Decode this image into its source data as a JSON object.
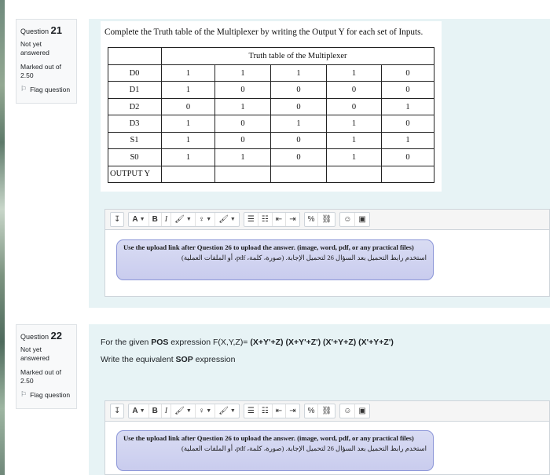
{
  "q21": {
    "label": "Question",
    "number": "21",
    "status": "Not yet answered",
    "marked": "Marked out of 2.50",
    "flag": "Flag question",
    "prompt": "Complete the Truth table of the Multiplexer by writing the Output Y for each set of Inputs.",
    "table": {
      "title": "Truth table of the Multiplexer",
      "rows": [
        {
          "label": "D0",
          "values": [
            "1",
            "1",
            "1",
            "1",
            "0"
          ]
        },
        {
          "label": "D1",
          "values": [
            "1",
            "0",
            "0",
            "0",
            "0"
          ]
        },
        {
          "label": "D2",
          "values": [
            "0",
            "1",
            "0",
            "0",
            "1"
          ]
        },
        {
          "label": "D3",
          "values": [
            "1",
            "0",
            "1",
            "1",
            "0"
          ]
        },
        {
          "label": "S1",
          "values": [
            "1",
            "0",
            "0",
            "1",
            "1"
          ]
        },
        {
          "label": "S0",
          "values": [
            "1",
            "1",
            "0",
            "1",
            "0"
          ]
        },
        {
          "label": "OUTPUT Y",
          "values": [
            "",
            "",
            "",
            "",
            ""
          ]
        }
      ]
    },
    "notice_en": "Use the upload link after Question 26 to upload the answer. (image, word, pdf, or any practical files)",
    "notice_ar": "استخدم رابط التحميل بعد السؤال 26 لتحميل الإجابة. (صورة، كلمة، pdf، أو الملفات العملية)"
  },
  "q22": {
    "label": "Question",
    "number": "22",
    "status": "Not yet answered",
    "marked": "Marked out of 2.50",
    "flag": "Flag question",
    "prompt_pre": "For the given ",
    "prompt_pos": "POS",
    "prompt_mid": " expression F(X,Y,Z)= ",
    "prompt_expr": "(X+Y'+Z) (X+Y'+Z') (X'+Y+Z) (X'+Y+Z')",
    "line2_pre": "Write the equivalent ",
    "line2_sop": "SOP",
    "line2_post": " expression",
    "notice_en": "Use the upload link after Question 26 to upload the answer. (image, word, pdf, or any practical files)",
    "notice_ar": "استخدم رابط التحميل بعد السؤال 26 لتحميل الإجابة. (صورة، كلمة، pdf، أو الملفات العملية)"
  },
  "toolbar": {
    "collapse": "↧",
    "font": "A",
    "bold": "B",
    "italic": "I",
    "brush": "🖌",
    "bulb": "♀",
    "brush2": "🖌",
    "ul": "☰",
    "ol": "☷",
    "indent": "⇤",
    "outdent": "⇥",
    "link": "%",
    "unlink": "⛓",
    "emoji": "☺",
    "image": "▣"
  },
  "colors": {
    "accent_bg": "#e7f3f5",
    "callout_border": "#8c96d8",
    "info_bg": "#f8f9fa"
  }
}
